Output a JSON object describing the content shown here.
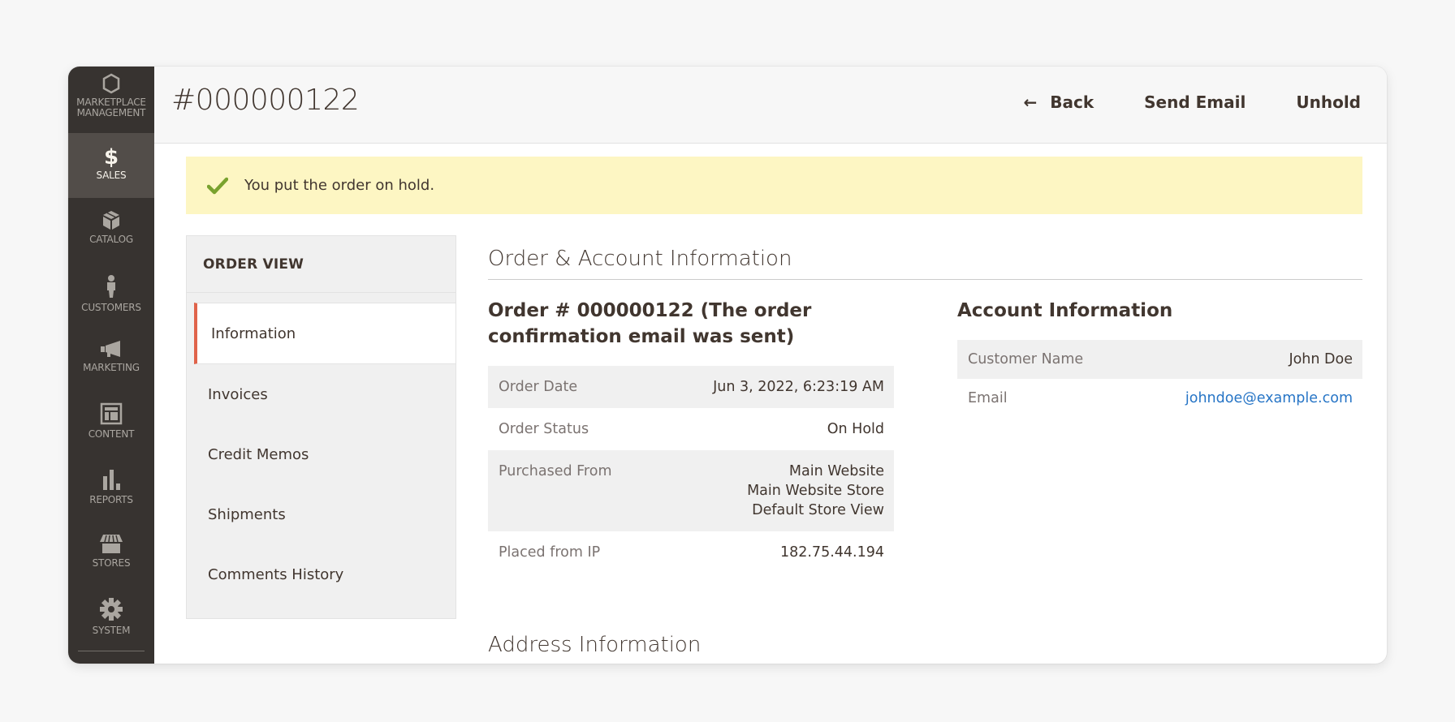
{
  "admin_menu": {
    "logo": {
      "icon": "hexagon-logo-icon",
      "label": "Marketplace Management"
    },
    "items": [
      {
        "id": "sales",
        "label": "Sales",
        "icon": "dollar-icon",
        "active": true
      },
      {
        "id": "catalog",
        "label": "Catalog",
        "icon": "box-icon",
        "active": false
      },
      {
        "id": "customers",
        "label": "Customers",
        "icon": "person-icon",
        "active": false
      },
      {
        "id": "marketing",
        "label": "Marketing",
        "icon": "megaphone-icon",
        "active": false
      },
      {
        "id": "content",
        "label": "Content",
        "icon": "layout-icon",
        "active": false
      },
      {
        "id": "reports",
        "label": "Reports",
        "icon": "bar-chart-icon",
        "active": false
      },
      {
        "id": "stores",
        "label": "Stores",
        "icon": "storefront-icon",
        "active": false
      },
      {
        "id": "system",
        "label": "System",
        "icon": "gear-icon",
        "active": false
      }
    ]
  },
  "header": {
    "title": "#000000122",
    "actions": {
      "back": {
        "label": "Back",
        "icon": "arrow-left-icon"
      },
      "send_email": {
        "label": "Send Email"
      },
      "unhold": {
        "label": "Unhold"
      }
    }
  },
  "message": {
    "icon": "checkmark-icon",
    "text": "You put the order on hold.",
    "background": "#fdf6c3",
    "icon_color": "#79a22e"
  },
  "order_view": {
    "title": "ORDER VIEW",
    "tabs": [
      {
        "label": "Information",
        "active": true
      },
      {
        "label": "Invoices",
        "active": false
      },
      {
        "label": "Credit Memos",
        "active": false
      },
      {
        "label": "Shipments",
        "active": false
      },
      {
        "label": "Comments History",
        "active": false
      }
    ],
    "active_accent": "#e0634a"
  },
  "main": {
    "section_title": "Order & Account Information",
    "order": {
      "title": "Order # 000000122 (The order confirmation email was sent)",
      "rows": [
        {
          "label": "Order Date",
          "value": "Jun 3, 2022, 6:23:19 AM"
        },
        {
          "label": "Order Status",
          "value": "On Hold"
        },
        {
          "label": "Purchased From",
          "values": [
            "Main Website",
            "Main Website Store",
            "Default Store View"
          ]
        },
        {
          "label": "Placed from IP",
          "value": "182.75.44.194"
        }
      ]
    },
    "account": {
      "title": "Account Information",
      "rows": [
        {
          "label": "Customer Name",
          "value": "John Doe"
        },
        {
          "label": "Email",
          "value": "johndoe@example.com",
          "link": true
        }
      ],
      "link_color": "#2775c6"
    },
    "address_section_title": "Address Information"
  }
}
